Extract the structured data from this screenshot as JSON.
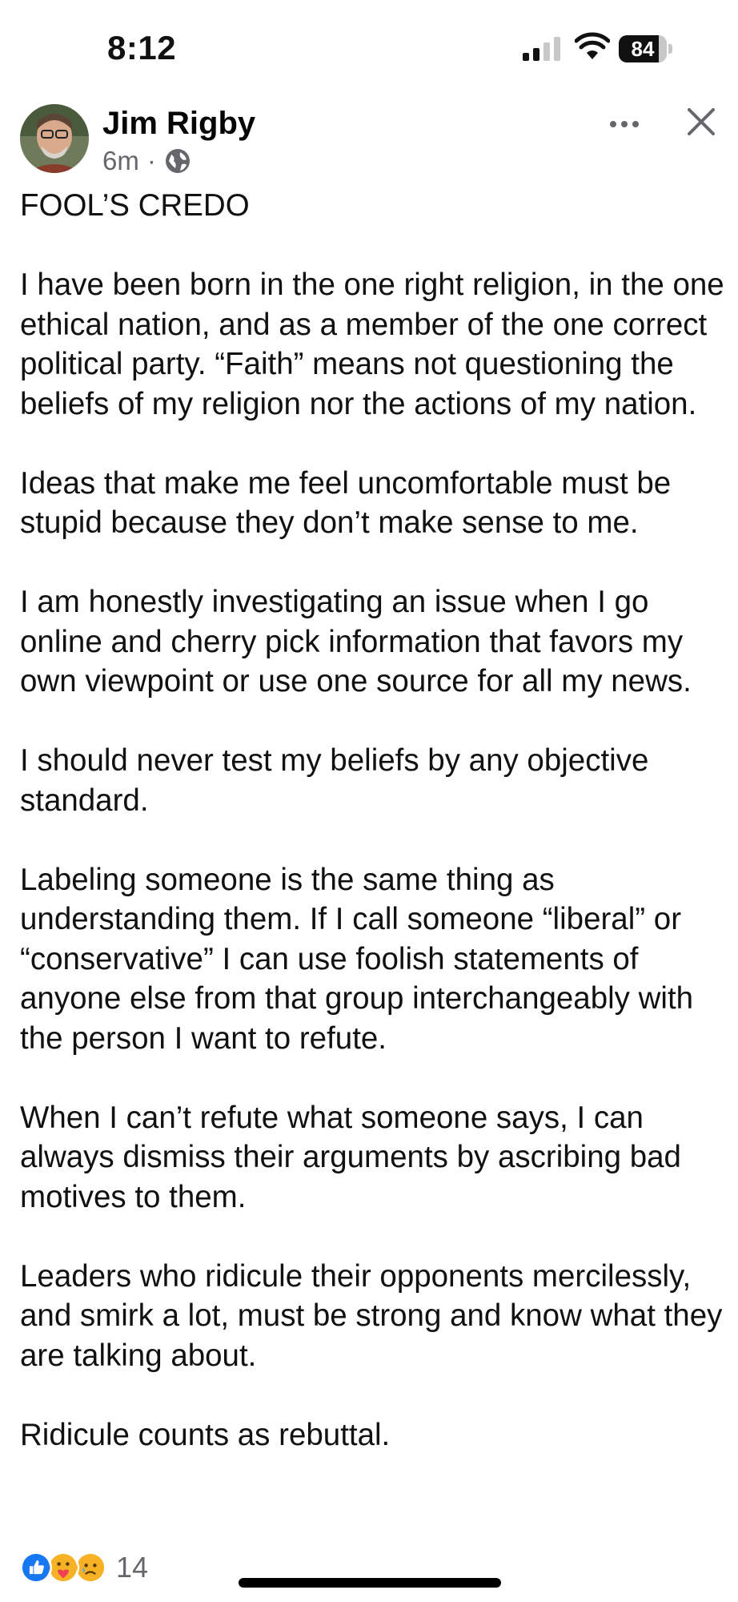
{
  "status_bar": {
    "time": "8:12",
    "battery_level": "84",
    "battery_percent": 84
  },
  "post": {
    "author": "Jim Rigby",
    "timestamp": "6m",
    "separator": "·",
    "audience_icon": "globe-icon",
    "title": "FOOL’S CREDO",
    "paragraphs": [
      "I have been born in the one right religion, in the one ethical nation, and as a member of the one correct political party. “Faith” means not questioning the beliefs of my religion nor the actions of my nation.",
      "Ideas that make me feel uncomfortable must be stupid because they don’t make sense to me.",
      "I am honestly investigating an issue when I go online and cherry pick information that favors my own viewpoint or use one source for all my news.",
      "I should never test my beliefs by any objective standard.",
      "Labeling someone is the same thing as understanding them. If I call someone “liberal” or “conservative” I can use foolish statements of anyone else from that group interchangeably with the person I want to refute.",
      "When I can’t refute what someone says, I can always dismiss their arguments by ascribing bad motives to them.",
      "Leaders who ridicule their opponents mercilessly, and smirk a lot, must be strong and know what they are talking about.",
      "Ridicule counts as rebuttal."
    ]
  },
  "reactions": {
    "icons": [
      "like-icon",
      "care-icon",
      "sad-icon"
    ],
    "count": "14"
  },
  "colors": {
    "like_blue": "#1877f2",
    "reaction_yellow": "#f7b125",
    "meta_gray": "#65676b"
  }
}
